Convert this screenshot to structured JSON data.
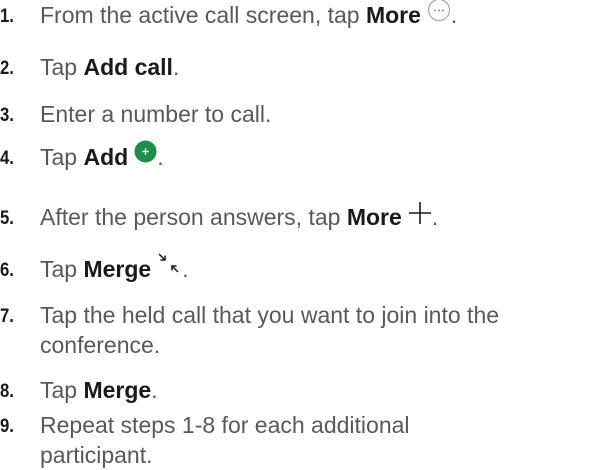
{
  "steps": [
    {
      "num": "1.",
      "pre": "From the active call screen, tap ",
      "bold": "More",
      "post": ".",
      "icon": "more-circle-icon"
    },
    {
      "num": "2.",
      "pre": "Tap ",
      "bold": "Add call",
      "post": "."
    },
    {
      "num": "3.",
      "text": "Enter a number to call."
    },
    {
      "num": "4.",
      "pre": "Tap ",
      "bold": "Add",
      "post": ".",
      "icon": "add-green-circle-icon"
    },
    {
      "num": "5.",
      "pre": "After the person answers, tap ",
      "bold": "More",
      "post": ".",
      "icon": "plus-icon"
    },
    {
      "num": "6.",
      "pre": "Tap ",
      "bold": "Merge",
      "post": ".",
      "icon": "merge-arrows-icon"
    },
    {
      "num": "7.",
      "line1": "Tap the held call that you want to join into the",
      "line2": "conference."
    },
    {
      "num": "8.",
      "pre": "Tap ",
      "bold": "Merge",
      "post": "."
    },
    {
      "num": "9.",
      "line1": "Repeat steps 1-8 for each additional",
      "line2": "participant."
    }
  ],
  "colors": {
    "text": "#595959",
    "bold": "#1a1a1a",
    "add_green": "#1e8f4a",
    "icon_outline": "#a8a8a8"
  }
}
